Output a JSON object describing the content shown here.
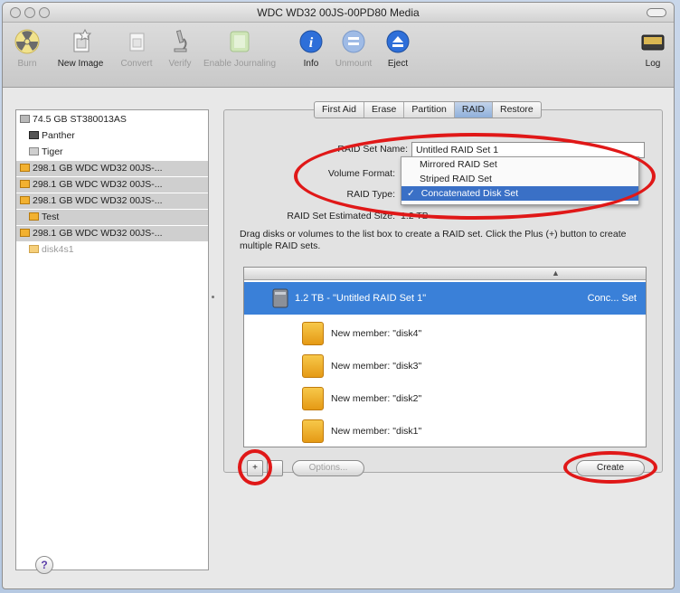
{
  "window": {
    "title": "WDC WD32 00JS-00PD80 Media"
  },
  "toolbar": {
    "burn": "Burn",
    "new_image": "New Image",
    "convert": "Convert",
    "verify": "Verify",
    "enable_journaling": "Enable Journaling",
    "info": "Info",
    "unmount": "Unmount",
    "eject": "Eject",
    "log": "Log"
  },
  "sidebar": {
    "items": [
      {
        "label": "74.5 GB ST380013AS"
      },
      {
        "label": "Panther"
      },
      {
        "label": "Tiger"
      },
      {
        "label": "298.1 GB WDC WD32 00JS-..."
      },
      {
        "label": "298.1 GB WDC WD32 00JS-..."
      },
      {
        "label": "298.1 GB WDC WD32 00JS-..."
      },
      {
        "label": "Test"
      },
      {
        "label": "298.1 GB WDC WD32 00JS-..."
      },
      {
        "label": "disk4s1"
      }
    ]
  },
  "tabs": [
    "First Aid",
    "Erase",
    "Partition",
    "RAID",
    "Restore"
  ],
  "form": {
    "raid_set_name_label": "RAID Set Name:",
    "raid_set_name_value": "Untitled RAID Set 1",
    "volume_format_label": "Volume Format:",
    "raid_type_label": "RAID Type:",
    "estimated_size_label": "RAID Set Estimated Size:",
    "estimated_size_value": "1.2 TB"
  },
  "raid_type_menu": {
    "options": [
      "Mirrored RAID Set",
      "Striped RAID Set",
      "Concatenated Disk Set"
    ],
    "checkmark": "✓"
  },
  "instructions": "Drag disks or volumes to the list box to create a RAID set. Click the Plus (+) button to create multiple RAID sets.",
  "raid_list": {
    "set_label": "1.2 TB - \"Untitled RAID Set 1\"",
    "set_type": "Conc... Set",
    "members": [
      "New member: \"disk4\"",
      "New member: \"disk3\"",
      "New member: \"disk2\"",
      "New member: \"disk1\""
    ]
  },
  "buttons": {
    "plus": "+",
    "options": "Options...",
    "create": "Create",
    "help": "?"
  },
  "colors": {
    "highlight_oval": "#e01818",
    "selection_blue": "#3a80d8",
    "menu_selected": "#3a70c6"
  }
}
